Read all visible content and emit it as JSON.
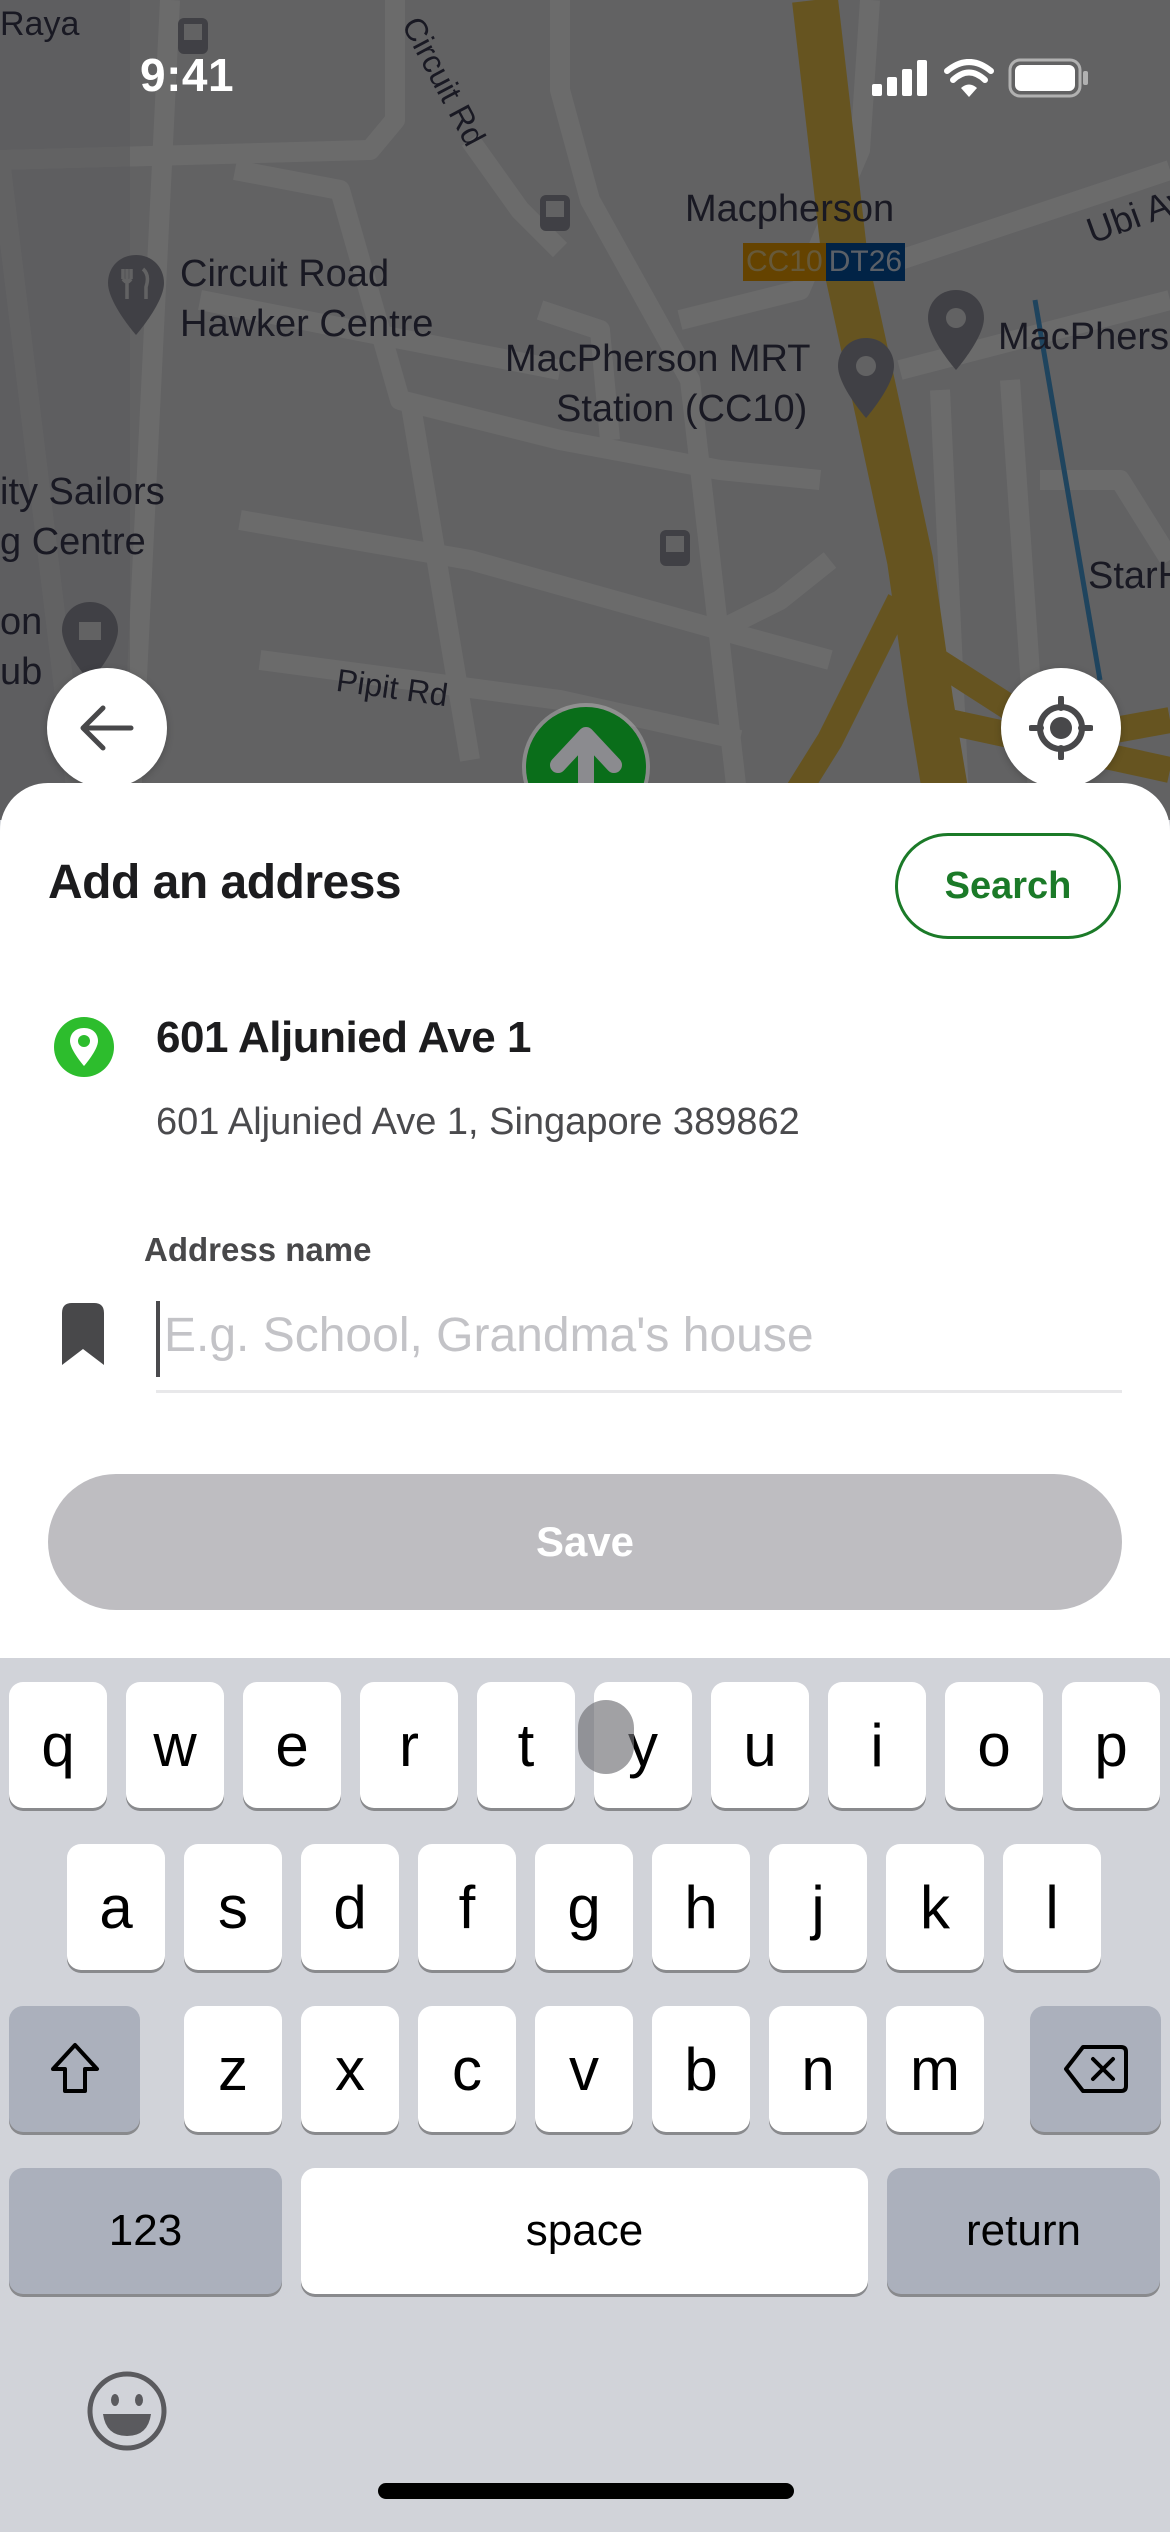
{
  "status_bar": {
    "time": "9:41",
    "icons": [
      "cellular-signal-icon",
      "wifi-icon",
      "battery-icon"
    ]
  },
  "map": {
    "labels": {
      "raya": "Raya",
      "circuit_rd": "Circuit Rd",
      "macpherson": "Macpherson",
      "mrt_cc": "CC10",
      "mrt_dt": "DT26",
      "ubi_ave": "Ubi Av",
      "hawker_line1": "Circuit Road",
      "hawker_line2": "Hawker Centre",
      "mrt_station_line1": "MacPherson MRT",
      "mrt_station_line2": "Station (CC10)",
      "macphers_right": "MacPhers",
      "sailors_line1": "ity Sailors",
      "sailors_line2": "g Centre",
      "club_line1": "on",
      "club_line2": "ub",
      "starhub": "StarHu",
      "pipit_rd": "Pipit Rd"
    },
    "colors": {
      "expressway": "#f2c94c",
      "mrt_cc": "#f0a100",
      "mrt_dt": "#0354a6",
      "current_marker": "#0a6e1a"
    }
  },
  "buttons": {
    "back_icon": "arrow-left-icon",
    "locate_icon": "crosshair-icon"
  },
  "sheet": {
    "title": "Add an address",
    "search_label": "Search",
    "location": {
      "name": "601 Aljunied Ave 1",
      "full_address": "601 Aljunied Ave 1, Singapore 389862"
    },
    "address_name": {
      "label": "Address name",
      "value": "",
      "placeholder": "E.g. School, Grandma's house"
    },
    "save_label": "Save",
    "colors": {
      "accent": "#1b7a28",
      "pin": "#2dbd2d",
      "save_disabled": "#bebdc1"
    }
  },
  "keyboard": {
    "row1": [
      "q",
      "w",
      "e",
      "r",
      "t",
      "y",
      "u",
      "i",
      "o",
      "p"
    ],
    "row2": [
      "a",
      "s",
      "d",
      "f",
      "g",
      "h",
      "j",
      "k",
      "l"
    ],
    "row3": [
      "z",
      "x",
      "c",
      "v",
      "b",
      "n",
      "m"
    ],
    "numbers_label": "123",
    "space_label": "space",
    "return_label": "return"
  }
}
